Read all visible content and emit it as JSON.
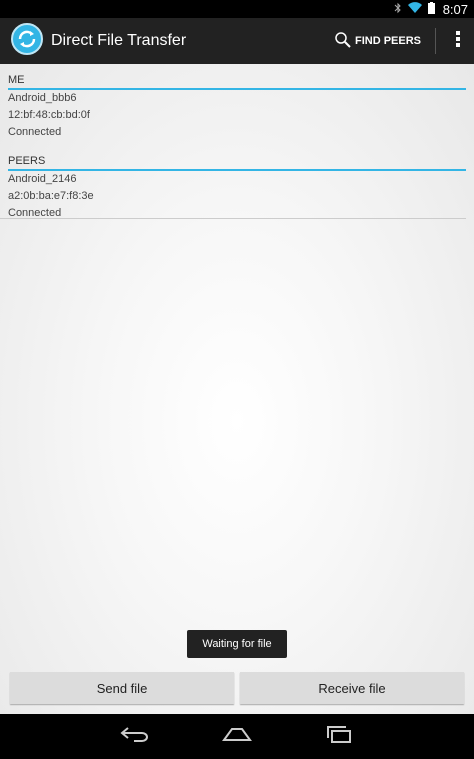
{
  "status_bar": {
    "time": "8:07"
  },
  "action_bar": {
    "title": "Direct File Transfer",
    "find_peers_label": "FIND PEERS"
  },
  "me": {
    "header": "ME",
    "name": "Android_bbb6",
    "mac": "12:bf:48:cb:bd:0f",
    "status": "Connected"
  },
  "peers": {
    "header": "PEERS",
    "items": [
      {
        "name": "Android_2146",
        "mac": "a2:0b:ba:e7:f8:3e",
        "status": "Connected"
      }
    ]
  },
  "toast": {
    "text": "Waiting for file"
  },
  "buttons": {
    "send_label": "Send file",
    "receive_label": "Receive file"
  },
  "colors": {
    "accent": "#33b5e5",
    "action_bar": "#222222"
  }
}
